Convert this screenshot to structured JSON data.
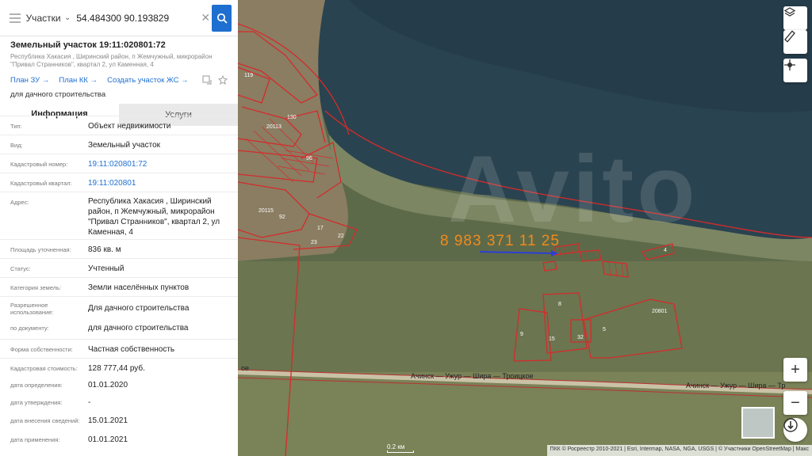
{
  "search": {
    "type_label": "Участки",
    "query": "54.484300 90.193829"
  },
  "parcel": {
    "title": "Земельный участок 19:11:020801:72",
    "address_short": "Республика Хакасия , Ширинский район, п Жемчужный, микрорайон \"Привал Странников\", квартал 2, ул Каменная, 4",
    "links": [
      {
        "label": "План ЗУ"
      },
      {
        "label": "План КК"
      },
      {
        "label": "Создать участок ЖС"
      }
    ],
    "purpose": "для дачного строительства"
  },
  "tabs": [
    {
      "label": "Информация",
      "active": true
    },
    {
      "label": "Услуги",
      "active": false
    }
  ],
  "rows": [
    {
      "label": "Тип:",
      "value": "Объект недвижимости"
    },
    {
      "label": "Вид:",
      "value": "Земельный участок"
    },
    {
      "label": "Кадастровый номер:",
      "value": "19:11:020801:72",
      "link": true
    },
    {
      "label": "Кадастровый квартал:",
      "value": "19:11:020801",
      "link": true
    },
    {
      "label": "Адрес:",
      "value": "Республика Хакасия , Ширинский район, п Жемчужный, микрорайон \"Привал Странников\", квартал 2, ул Каменная, 4"
    },
    {
      "label": "Площадь уточненная:",
      "value": "836 кв. м"
    },
    {
      "label": "Статус:",
      "value": "Учтенный"
    },
    {
      "label": "Категория земель:",
      "value": "Земли населённых пунктов"
    },
    {
      "label": "Разрешенное использование:",
      "value": "Для дачного строительства"
    },
    {
      "label": "по документу:",
      "value": "для дачного строительства"
    },
    {
      "label": "Форма собственности:",
      "value": "Частная собственность"
    },
    {
      "label": "Кадастровая стоимость:",
      "value": "128 777,44 руб."
    },
    {
      "label": "дата определения:",
      "value": "01.01.2020"
    },
    {
      "label": "дата утверждения:",
      "value": "-"
    },
    {
      "label": "дата внесения сведений:",
      "value": "15.01.2021"
    },
    {
      "label": "дата применения:",
      "value": "01.01.2021"
    }
  ],
  "map": {
    "overlay_phone": "8 983 371 11 25",
    "watermark": "Avito",
    "road_label": "Ачинск — Ужур — Шира — Троицкое",
    "road_label_2": "Ачинск — Ужур — Шира — Тр",
    "road_label_start": "ое",
    "scale": "0.2 км",
    "attribution": "ПКК © Росреестр 2010-2021 | Esri, Intermap, NASA, NGA, USGS | © Участники OpenStreetMap | Макс",
    "parcel_numbers": [
      "119",
      "130",
      "20113",
      "96",
      "20115",
      "92",
      "17",
      "22",
      "23",
      "4",
      "8",
      "15",
      "9",
      "32",
      "5",
      "20801"
    ],
    "controls": {
      "layers_icon": "layers-icon",
      "ruler_icon": "ruler-icon",
      "locate_icon": "crosshair-icon",
      "zoom_in": "+",
      "zoom_out": "−"
    }
  }
}
